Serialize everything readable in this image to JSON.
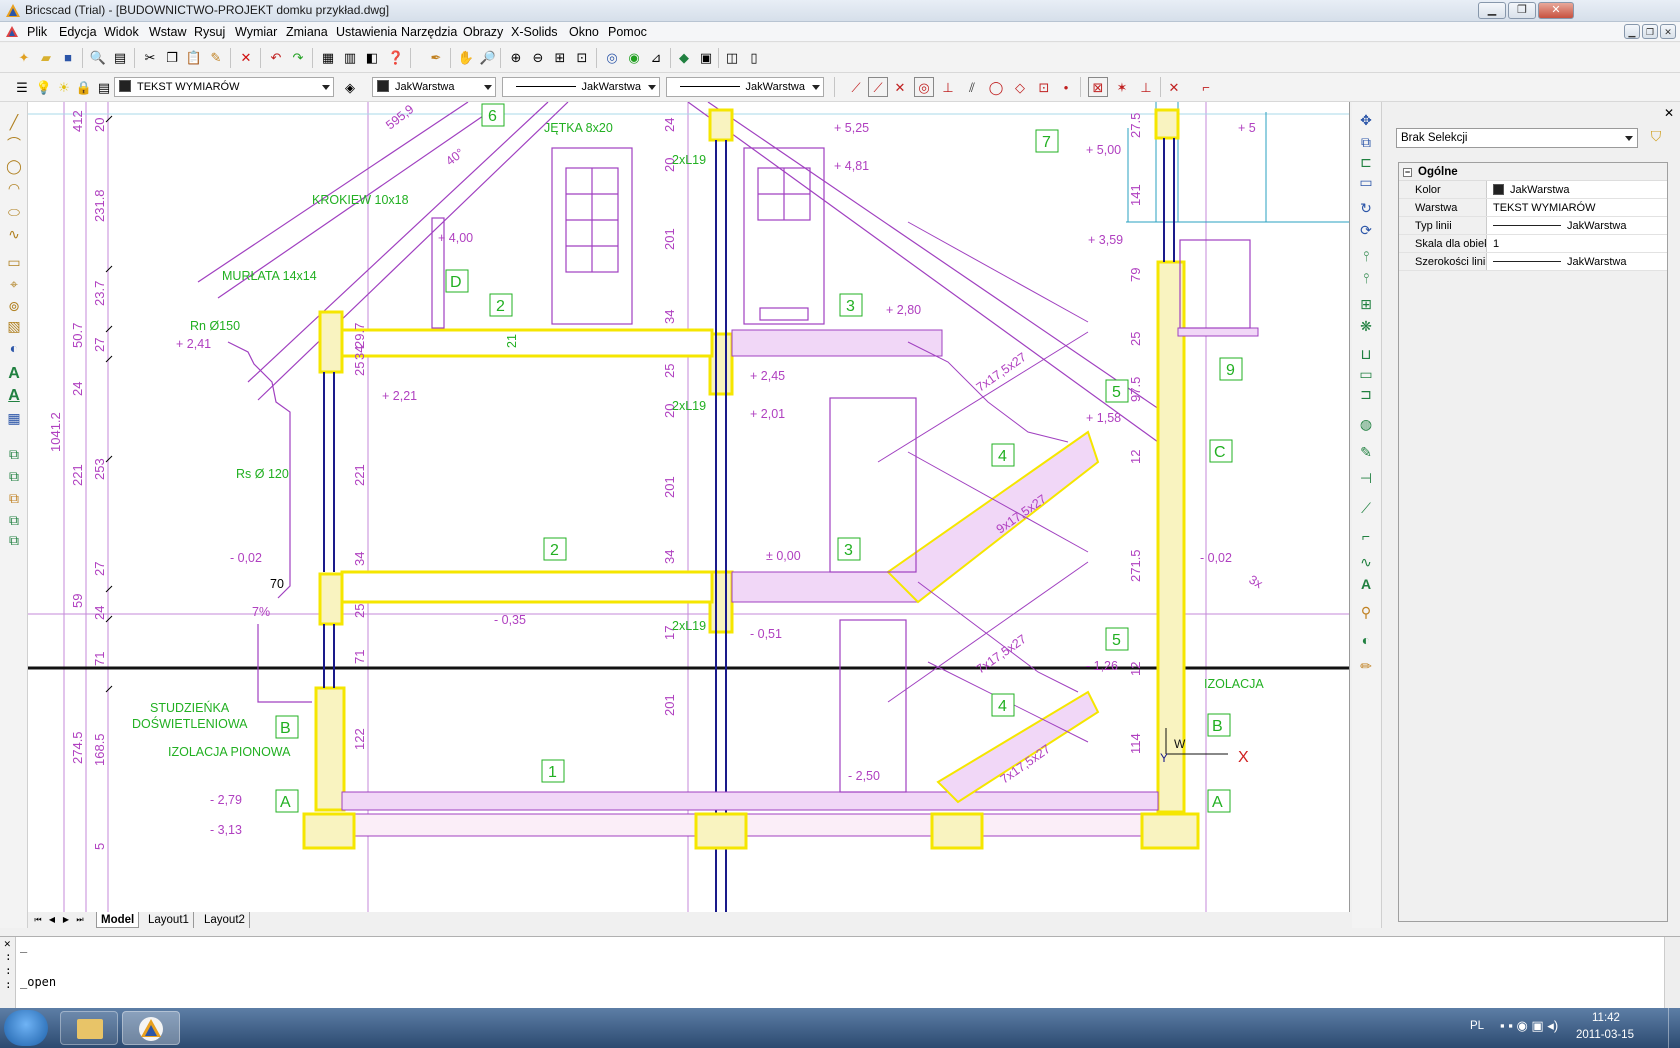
{
  "window": {
    "title": "Bricscad (Trial) - [BUDOWNICTWO-PROJEKT domku przykład.dwg]"
  },
  "menu": [
    "Plik",
    "Edycja",
    "Widok",
    "Wstaw",
    "Rysuj",
    "Wymiar",
    "Zmiana",
    "Ustawienia",
    "Narzędzia",
    "Obrazy",
    "X-Solids",
    "Okno",
    "Pomoc"
  ],
  "layer_bar": {
    "layer": "TEKST WYMIARÓW",
    "color": "JakWarstwa",
    "linetype": "JakWarstwa",
    "lineweight": "JakWarstwa"
  },
  "properties": {
    "selection": "Brak Selekcji",
    "group": "Ogólne",
    "rows": [
      {
        "key": "Kolor",
        "value": "JakWarstwa"
      },
      {
        "key": "Warstwa",
        "value": "TEKST WYMIARÓW"
      },
      {
        "key": "Typ linii",
        "value": "JakWarstwa"
      },
      {
        "key": "Skala dla obiektu",
        "value": "1"
      },
      {
        "key": "Szerokości linii",
        "value": "JakWarstwa"
      }
    ]
  },
  "tabs": [
    "Model",
    "Layout1",
    "Layout2"
  ],
  "command": {
    "lines": [
      "_",
      "",
      "_open"
    ]
  },
  "taskbar": {
    "lang": "PL",
    "time": "11:42",
    "date": "2011-03-15"
  },
  "drawing": {
    "labels_left": [
      "412",
      "231.8",
      "23.7",
      "50.7",
      "27",
      "24",
      "221",
      "253",
      "27",
      "59",
      "24",
      "71",
      "274.5",
      "168.5",
      "5",
      "20",
      "1041.2"
    ],
    "labels_mid": [
      "24",
      "20",
      "201",
      "34",
      "25",
      "20",
      "201",
      "34",
      "17",
      "201"
    ],
    "labels_mid2": [
      "29.7",
      "34",
      "25",
      "221",
      "34",
      "25",
      "71",
      "122"
    ],
    "labels_right": [
      "27.5",
      "141",
      "79",
      "25",
      "97.5",
      "12",
      "271.5",
      "12",
      "114"
    ],
    "levels": [
      "+ 5,25",
      "+ 4,81",
      "+ 5,00",
      "+ 3,59",
      "+ 4,00",
      "+ 2,80",
      "+ 2,41",
      "+ 2,21",
      "+ 2,45",
      "+ 2,01",
      "+ 1,58",
      "- 0,02",
      "± 0,00",
      "- 0,02",
      "- 0,35",
      "- 0,51",
      "- 1,26",
      "- 2,50",
      "- 2,79",
      "- 3,13",
      "+ 5"
    ],
    "texts": [
      "JĘTKA 8x20",
      "KROKIEW 10x18",
      "MURŁATA 14x14",
      "Rn Ø150",
      "Rs Ø 120",
      "STUDZIEŃKA",
      "DOŚWIETLENIOWA",
      "IZOLACJA PIONOWA",
      "IZOLACJA",
      "2xL19",
      "2xL19",
      "2xL19",
      "595,9",
      "40°",
      "70",
      "7%",
      "7x17,5x27",
      "9x17,5x27",
      "7x17,5x27",
      "7x17,5x27",
      "3x",
      "21",
      "W",
      "X",
      "Y"
    ],
    "boxes": [
      "6",
      "7",
      "D",
      "2",
      "3",
      "5",
      "9",
      "C",
      "4",
      "2",
      "3",
      "5",
      "4",
      "1",
      "A",
      "B",
      "B",
      "A"
    ]
  }
}
